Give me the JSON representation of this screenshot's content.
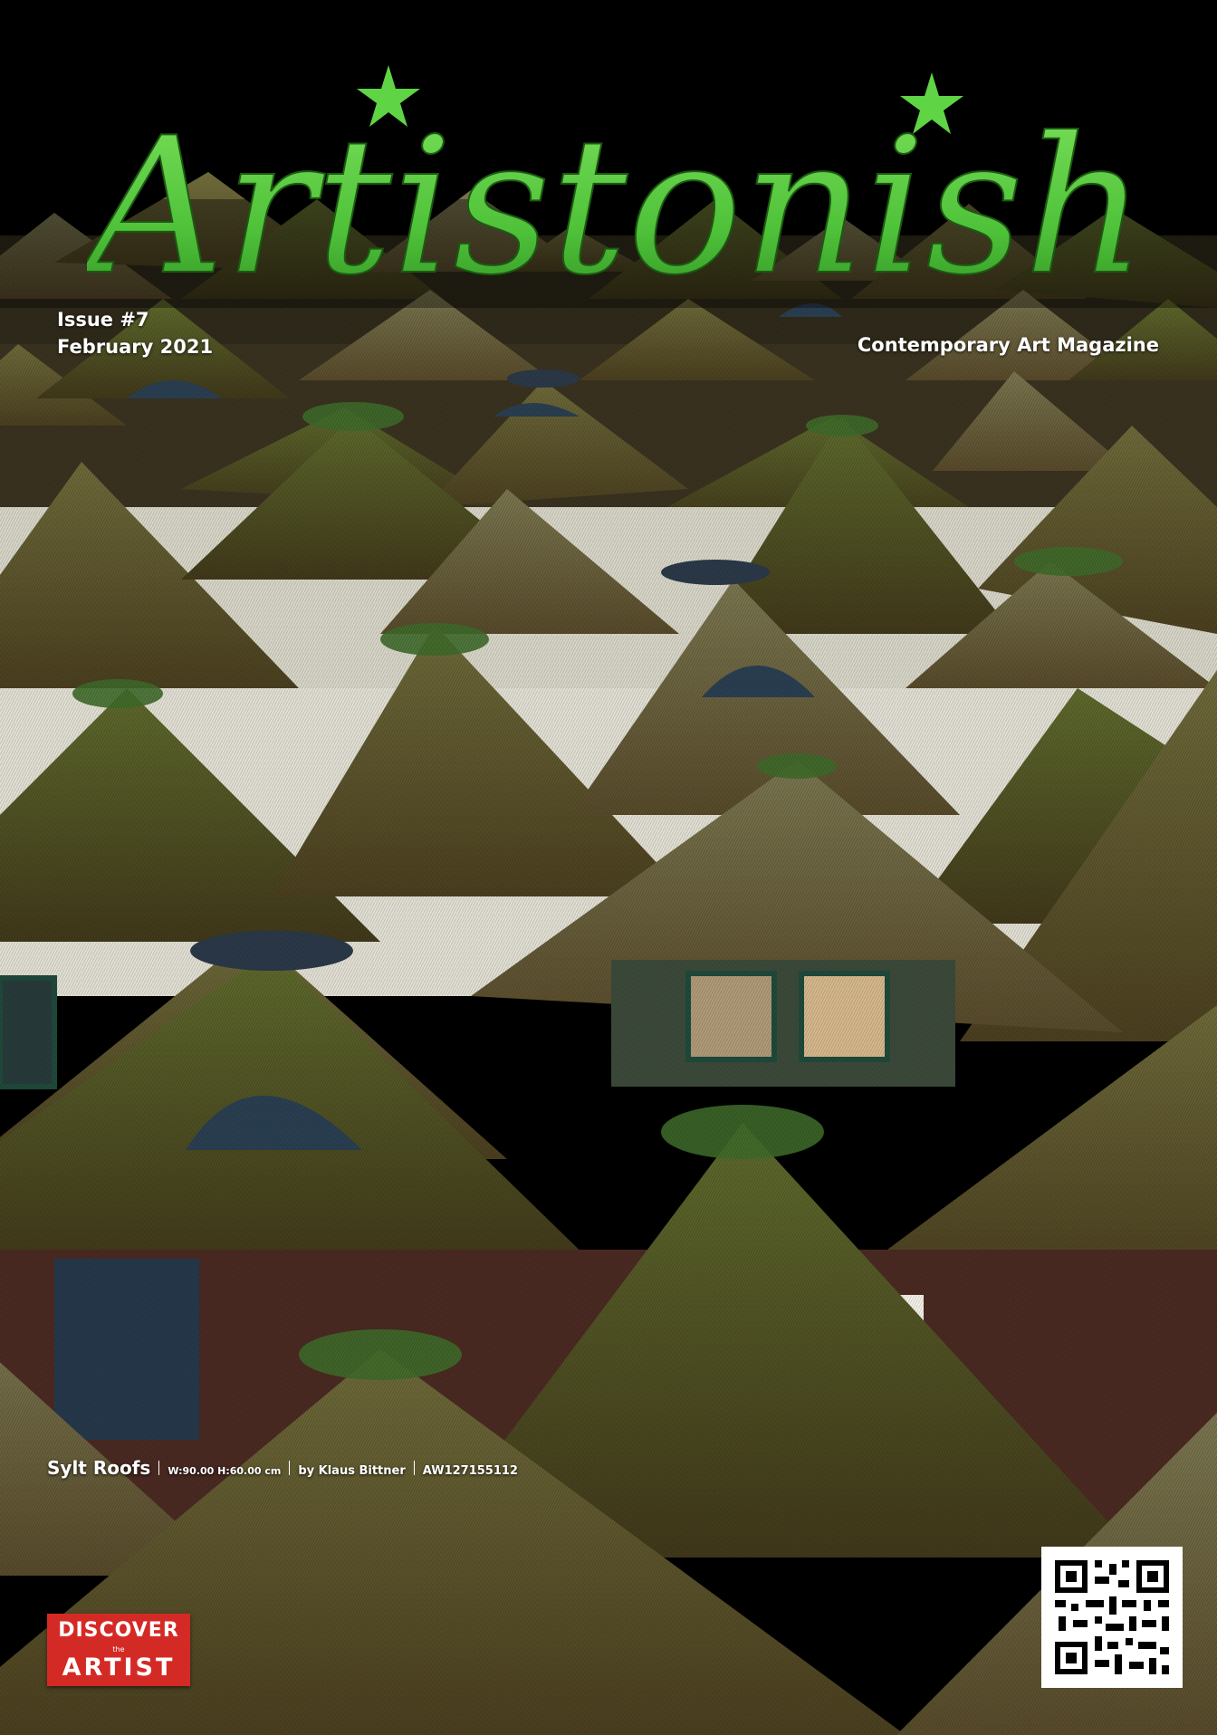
{
  "magazine": {
    "name": "Artistonish",
    "accent_color": "#4fc23a",
    "issue": "Issue #7",
    "date": "February 2021",
    "tagline": "Contemporary Art Magazine"
  },
  "artwork": {
    "title": "Sylt Roofs",
    "dimensions": "W:90.00 H:60.00 cm",
    "artist": "by Klaus Bittner",
    "code": "AW127155112"
  },
  "logo": {
    "line1": "DISCOVER",
    "line2": "the",
    "line3": "ARTIST",
    "color": "#d42a25"
  },
  "qr": {
    "icon": "qr-code-icon"
  }
}
